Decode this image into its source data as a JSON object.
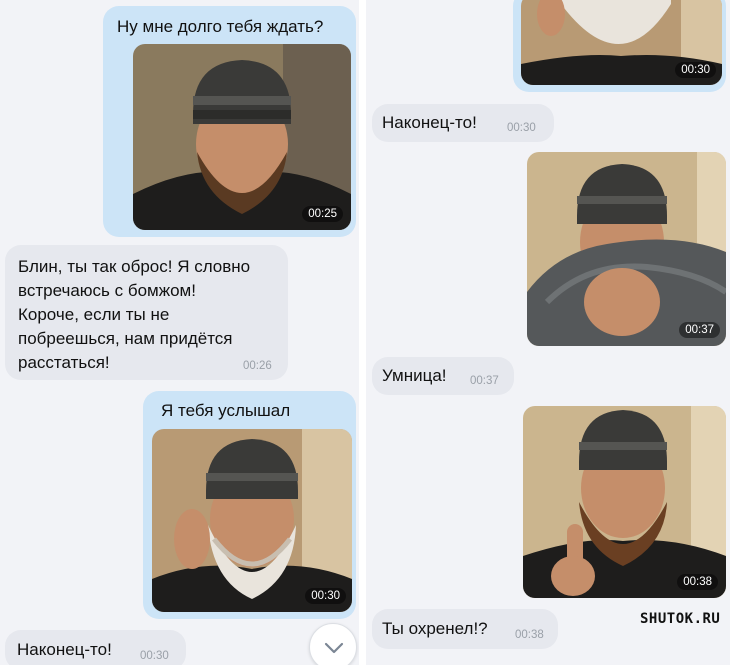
{
  "left": {
    "m1": {
      "text": "Ну мне долго тебя ждать?",
      "photo_time": "00:25"
    },
    "m2": {
      "lines": [
        "Блин, ты так оброс! Я словно",
        "встречаюсь с бомжом!",
        "Короче, если ты не",
        "побреешься, нам придётся",
        "расстаться!"
      ],
      "time": "00:26"
    },
    "m3": {
      "text": "Я тебя услышал",
      "photo_time": "00:30"
    },
    "m4": {
      "text": "Наконец-то!",
      "time": "00:30"
    }
  },
  "right": {
    "m1": {
      "photo_time": "00:30"
    },
    "m2": {
      "text": "Наконец-то!",
      "time": "00:30"
    },
    "m3": {
      "photo_time": "00:37"
    },
    "m4": {
      "text": "Умница!",
      "time": "00:37"
    },
    "m5": {
      "photo_time": "00:38"
    },
    "m6": {
      "text": "Ты охренел!?",
      "time": "00:38"
    }
  },
  "scroll_button": {
    "icon": "chevron-down-icon"
  },
  "watermark": "SHUTOK.RU",
  "colors": {
    "outgoing_bubble": "#cce4f7",
    "incoming_bubble": "#e6e8ee",
    "background": "#f2f3f7"
  }
}
